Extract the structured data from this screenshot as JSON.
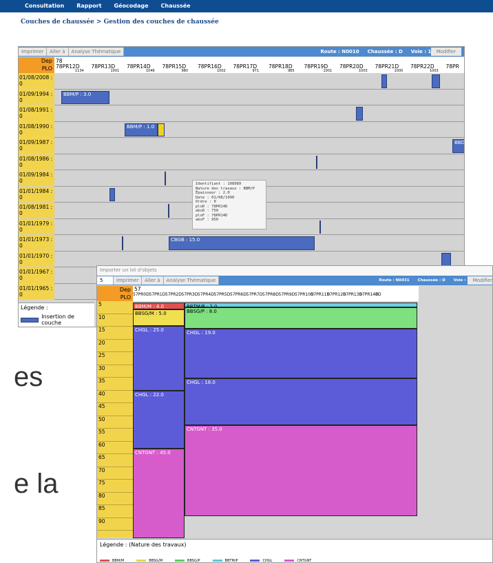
{
  "topnav": [
    "Consultation",
    "Rapport",
    "Géocodage",
    "Chaussée"
  ],
  "breadcrumb": "Couches de chaussée > Gestion des couches de chaussée",
  "w1": {
    "toolbar": {
      "buttons": [
        "Imprimer",
        "Aller à",
        "Analyse Thématique"
      ],
      "route": "Route : N0010",
      "chaussee": "Chaussée : D",
      "voie": "Voie : 1",
      "modify": "Modifier"
    },
    "dep": "Dep",
    "plo": "PLO",
    "dep_value": "78",
    "pr_labels": [
      "78PR12D",
      "78PR13D",
      "78PR14D",
      "78PR15D",
      "78PR16D",
      "78PR17D",
      "78PR18D",
      "78PR19D",
      "78PR20D",
      "78PR21D",
      "78PR22D",
      "78PR"
    ],
    "pr_values": [
      "1134",
      "1001",
      "1046",
      "980",
      "1002",
      "971",
      "985",
      "1001",
      "1003",
      "1000",
      "1003",
      ""
    ],
    "dates": [
      "01/08/2008 : 0",
      "01/09/1994 : 0",
      "01/08/1991 : 0",
      "01/08/1990 : 0",
      "01/09/1987 : 0",
      "01/08/1986 : 0",
      "01/09/1984 : 0",
      "01/01/1984 : 0",
      "01/08/1981 : 0",
      "01/01/1979 : 0",
      "01/01/1973 : 0",
      "01/01/1970 : 0",
      "01/01/1967 : 0",
      "01/01/1965 : 0"
    ],
    "seg_labels": {
      "bbm_p_30": "BBM/P : 3.0",
      "bbm_p_10": "BBM/P : 1.0",
      "cbgb": "CBGB : 15.0",
      "bbd": "BBD"
    },
    "tooltip": [
      "Identifiant : 108989",
      "Nature des travaux : BBM/P",
      "Épaisseur : 2.0",
      "Date : 01/08/1990",
      "Ordre : 0",
      "ploD : 78PR14D",
      "absD : 750",
      "ploF : 78PR14D",
      "absF : 950"
    ],
    "legend_title": "Légende :",
    "legend_item": "Insertion de couche"
  },
  "w2": {
    "top_title": "Importer un lot d'objets",
    "input_value": "5",
    "toolbar": {
      "buttons": [
        "Imprimer",
        "Aller à",
        "Analyse Thématique"
      ],
      "route": "Route : N0431",
      "chaussee": "Chaussée : D",
      "voie": "Voie : 1",
      "modify": "Modifier"
    },
    "dep": "Dep",
    "plo": "PLO",
    "dep_value": "57",
    "pr_labels": [
      "57PR0D",
      "57PR1D",
      "57PR2D",
      "57PR3D",
      "57PR4D",
      "57PR5D",
      "57PR6D",
      "57PR7D",
      "57PR8D",
      "57PR9D",
      "57PR10D",
      "57PR11D",
      "57PR12D",
      "57PR13D",
      "57PR14D",
      "FD"
    ],
    "row_labels": [
      "5",
      "10",
      "15",
      "20",
      "25",
      "30",
      "35",
      "40",
      "45",
      "50",
      "55",
      "60",
      "65",
      "70",
      "75",
      "80",
      "85",
      "90"
    ],
    "layers": {
      "bbm_m": "BBM/M : 4.0",
      "bbtm": "BBTM/P : 2.0",
      "bbsg_m": "BBSG/M : 5.0",
      "bbsg_p": "BBSG/P : 8.0",
      "chgl25": "CHGL : 25.0",
      "chgl19": "CHGL : 19.0",
      "chgl18": "CHGL : 18.0",
      "chgl22": "CHGL : 22.0",
      "cnt35": "CNTGNT : 35.0",
      "cnt45": "CNTGNT : 45.0"
    },
    "legend_title": "Légende : (Nature des travaux)",
    "legend": [
      {
        "label": "BBM/M",
        "color": "#e05050"
      },
      {
        "label": "BBSG/M",
        "color": "#e6d44a"
      },
      {
        "label": "BBSG/P",
        "color": "#5ccc5c"
      },
      {
        "label": "BBTM/P",
        "color": "#56c8e0"
      },
      {
        "label": "CHGL",
        "color": "#5c5cd8"
      },
      {
        "label": "CNTGNT",
        "color": "#d65ccc"
      }
    ]
  },
  "bg_text": [
    "es",
    "e la"
  ]
}
